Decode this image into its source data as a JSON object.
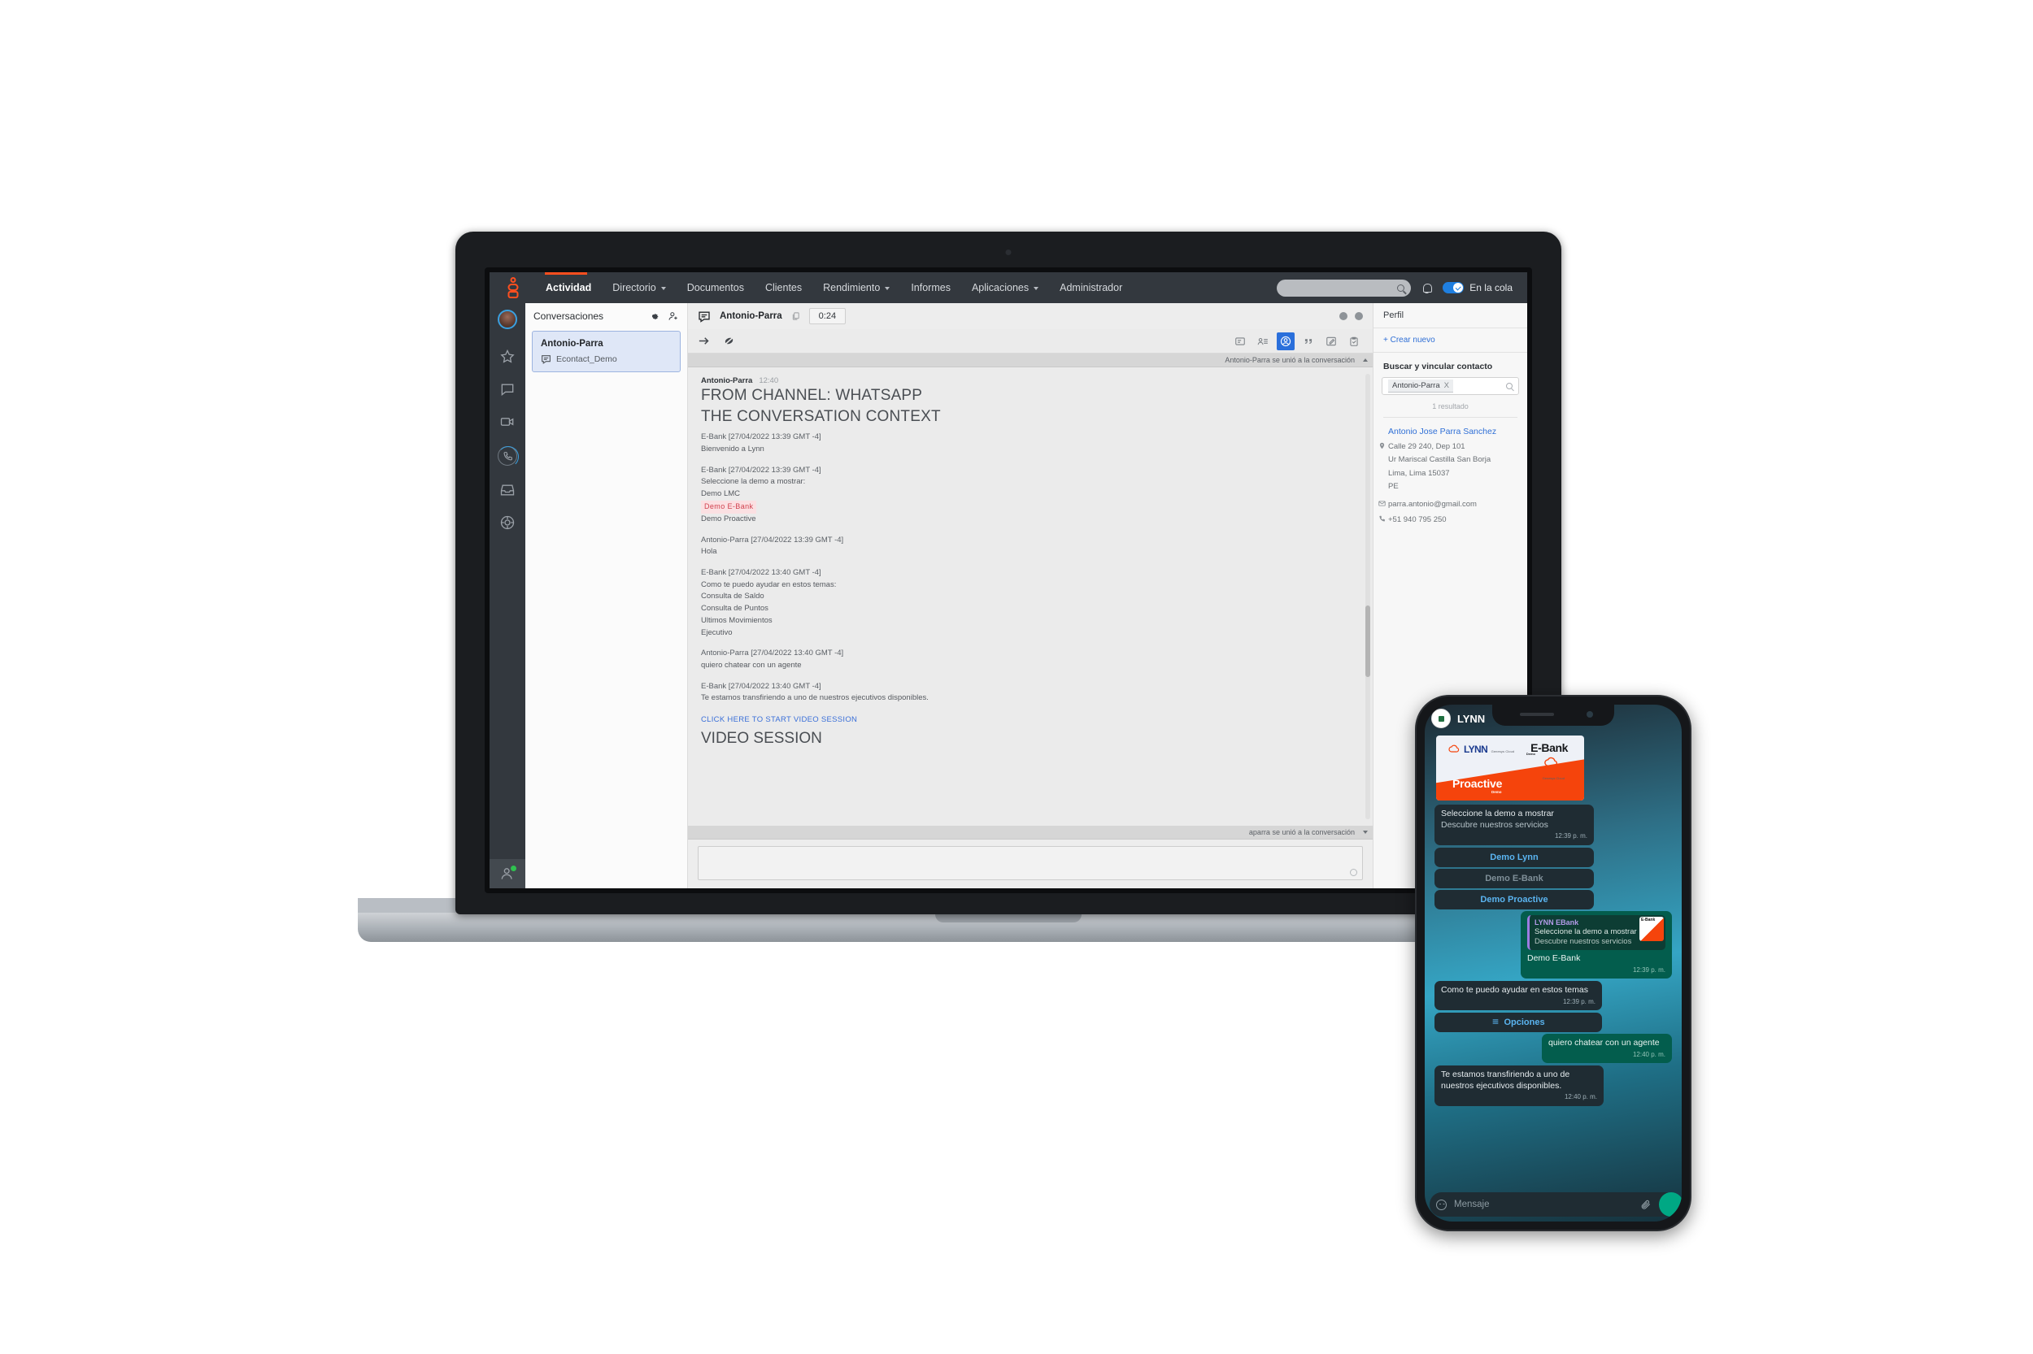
{
  "topnav": {
    "brand": "genesys-logo",
    "items": [
      {
        "label": "Actividad",
        "caret": false,
        "active": true
      },
      {
        "label": "Directorio",
        "caret": true,
        "active": false
      },
      {
        "label": "Documentos",
        "caret": false,
        "active": false
      },
      {
        "label": "Clientes",
        "caret": false,
        "active": false
      },
      {
        "label": "Rendimiento",
        "caret": true,
        "active": false
      },
      {
        "label": "Informes",
        "caret": false,
        "active": false
      },
      {
        "label": "Aplicaciones",
        "caret": true,
        "active": false
      },
      {
        "label": "Administrador",
        "caret": false,
        "active": false
      }
    ],
    "search_placeholder": "",
    "queue_label": "En la cola",
    "toggle_on": true,
    "accent": "#ff4f1f"
  },
  "rail": {
    "items": [
      "avatar",
      "star-icon",
      "chat-icon",
      "video-icon",
      "phone-icon",
      "inbox-icon",
      "target-icon",
      "agent-icon"
    ]
  },
  "conversations": {
    "title": "Conversaciones",
    "items": [
      {
        "name": "Antonio-Parra",
        "channel": "Econtact_Demo"
      }
    ]
  },
  "conversation_header": {
    "name": "Antonio-Parra",
    "timer": "0:24"
  },
  "transcript": {
    "join_top": "Antonio-Parra se unió a la conversación",
    "join_bottom": "aparra se unió a la conversación",
    "author": "Antonio-Parra",
    "author_time": "12:40",
    "headline_1": "FROM CHANNEL: WHATSAPP",
    "headline_2": "THE CONVERSATION CONTEXT",
    "blocks": [
      {
        "meta": "E-Bank [27/04/2022 13:39  GMT -4]",
        "lines": [
          "Bienvenido a Lynn"
        ]
      },
      {
        "meta": "E-Bank [27/04/2022 13:39  GMT -4]",
        "lines": [
          "Seleccione la demo a mostrar:",
          "Demo LMC"
        ],
        "highlight": "Demo  E-Bank",
        "lines_after": [
          "Demo Proactive"
        ]
      },
      {
        "meta": "Antonio-Parra [27/04/2022 13:39  GMT -4]",
        "lines": [
          "Hola"
        ]
      },
      {
        "meta": "E-Bank [27/04/2022 13:40  GMT -4]",
        "lines": [
          "Como te puedo ayudar en estos temas:",
          "Consulta de Saldo",
          "Consulta de Puntos",
          "Ultimos Movimientos",
          "Ejecutivo"
        ]
      },
      {
        "meta": "Antonio-Parra [27/04/2022 13:40  GMT -4]",
        "lines": [
          "quiero chatear con un agente"
        ]
      },
      {
        "meta": "E-Bank [27/04/2022 13:40  GMT -4]",
        "lines": [
          "Te estamos transfiriendo a uno de nuestros ejecutivos disponibles."
        ]
      }
    ],
    "video_link": "CLICK HERE TO START VIDEO SESSION",
    "video_title": "VIDEO SESSION"
  },
  "profile": {
    "title": "Perfil",
    "create_new": "+ Crear nuevo",
    "search_section": "Buscar y vincular contacto",
    "chip": "Antonio-Parra",
    "chip_remove": "X",
    "result_count": "1 resultado",
    "contact": {
      "name": "Antonio Jose Parra Sanchez",
      "address_1": "Calle 29 240, Dep 101",
      "address_2": "Ur Mariscal Castilla San Borja",
      "address_3": "Lima, Lima 15037",
      "address_4": "PE",
      "email": "parra.antonio@gmail.com",
      "phone": "+51 940 795 250"
    }
  },
  "phone": {
    "header_title": "LYNN",
    "card": {
      "lynn_word": "LYNN",
      "lynn_tm": "for",
      "lynn_sub": "Genesys Cloud",
      "ebank": "E-Bank",
      "ebank_demo": "Demo",
      "genesys_cloud": "Genesys Cloud",
      "proactive": "Proactive",
      "proactive_demo": "Demo"
    },
    "messages": [
      {
        "kind": "in",
        "text": "Seleccione la demo a mostrar",
        "sub": "Descubre nuestros servicios",
        "time": "12:39 p. m."
      },
      {
        "kind": "btn",
        "text": "Demo Lynn",
        "dim": false
      },
      {
        "kind": "btn",
        "text": "Demo E-Bank",
        "dim": true
      },
      {
        "kind": "btn",
        "text": "Demo Proactive",
        "dim": false
      },
      {
        "kind": "out-quote",
        "quote_name": "LYNN EBank",
        "quote_l1": "Seleccione la demo a mostrar",
        "quote_l2": "Descubre nuestros servicios",
        "text": "Demo E-Bank",
        "time": "12:39 p. m."
      },
      {
        "kind": "in",
        "text": "Como te puedo ayudar en estos temas",
        "time": "12:39 p. m."
      },
      {
        "kind": "btn-opt",
        "text": "Opciones"
      },
      {
        "kind": "out",
        "text": "quiero chatear con un agente",
        "time": "12:40 p. m."
      },
      {
        "kind": "in",
        "text": "Te estamos transfiriendo a uno de nuestros ejecutivos disponibles.",
        "time": "12:40 p. m."
      }
    ],
    "input_placeholder": "Mensaje"
  },
  "colors": {
    "genesys_orange": "#ff4f1f",
    "nav_dark": "#33383e",
    "accent_blue": "#2a6fdb",
    "whatsapp_in": "#1f2c33",
    "whatsapp_out": "#035d4d",
    "highlight_red": "#d0414e"
  }
}
